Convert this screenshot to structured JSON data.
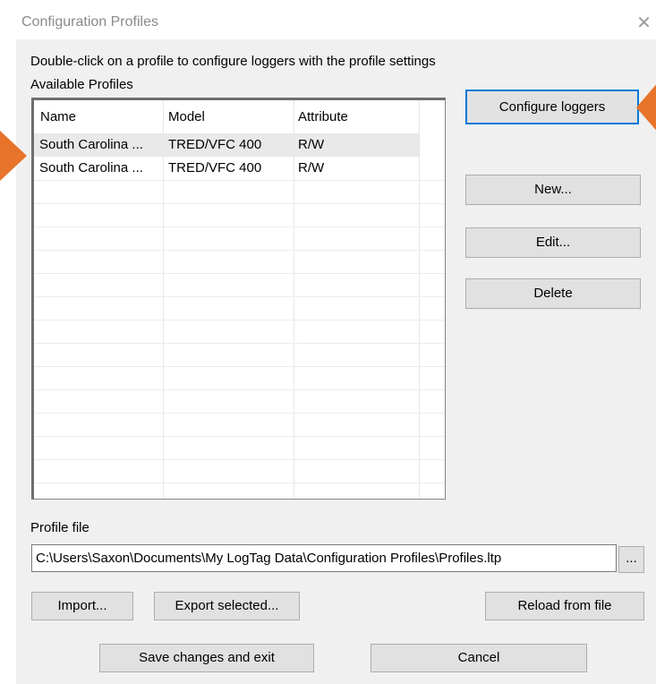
{
  "window": {
    "title": "Configuration Profiles",
    "close_glyph": "✕"
  },
  "instructions": "Double-click on a profile to configure loggers with the profile settings",
  "available_label": "Available Profiles",
  "table": {
    "columns": [
      "Name",
      "Model",
      "Attribute"
    ],
    "rows": [
      {
        "name": "South Carolina ...",
        "model": "TRED/VFC 400",
        "attribute": "R/W",
        "selected": true
      },
      {
        "name": "South Carolina ...",
        "model": "TRED/VFC 400",
        "attribute": "R/W",
        "selected": false
      }
    ]
  },
  "buttons": {
    "configure": "Configure loggers",
    "new": "New...",
    "edit": "Edit...",
    "delete": "Delete",
    "browse": "...",
    "import": "Import...",
    "export": "Export selected...",
    "reload": "Reload from file",
    "save": "Save changes and exit",
    "cancel": "Cancel"
  },
  "profile_file": {
    "label": "Profile file",
    "value": "C:\\Users\\Saxon\\Documents\\My LogTag Data\\Configuration Profiles\\Profiles.ltp"
  },
  "colors": {
    "callout_arrow": "#e8732a",
    "dialog_bg": "#f0f0f0",
    "button_bg": "#e1e1e1"
  },
  "icons": {
    "left_pointer": "callout-arrow",
    "right_pointer": "callout-arrow"
  }
}
